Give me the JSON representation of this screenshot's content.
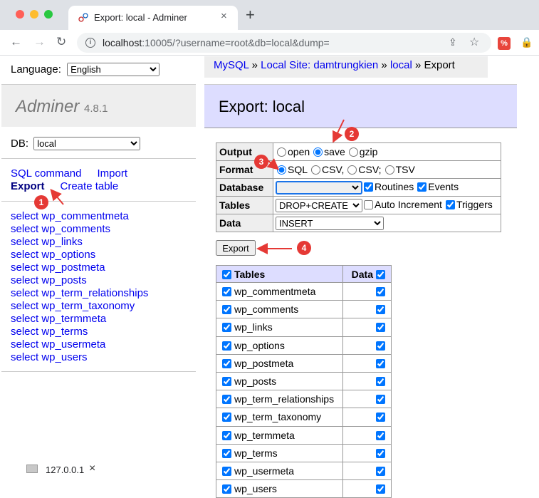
{
  "browser": {
    "tab_title": "Export: local - Adminer",
    "tab_close": "×",
    "new_tab": "+",
    "url_host": "localhost",
    "url_rest": ":10005/?username=root&db=local&dump=",
    "icons": [
      "back-icon",
      "forward-icon",
      "reload-icon",
      "info-icon",
      "share-icon",
      "star-icon",
      "extension-icon",
      "lock-extension-icon"
    ]
  },
  "sidebar": {
    "language_label": "Language:",
    "language_value": "English",
    "logo": "Adminer",
    "version": "4.8.1",
    "db_label": "DB:",
    "db_value": "local",
    "links": {
      "sql_command": "SQL command",
      "import": "Import",
      "export": "Export",
      "create_table": "Create table"
    },
    "tables": [
      "select wp_commentmeta",
      "select wp_comments",
      "select wp_links",
      "select wp_options",
      "select wp_postmeta",
      "select wp_posts",
      "select wp_term_relationships",
      "select wp_term_taxonomy",
      "select wp_termmeta",
      "select wp_terms",
      "select wp_usermeta",
      "select wp_users"
    ]
  },
  "breadcrumb": {
    "mysql": "MySQL",
    "sep": " » ",
    "site": "Local Site: damtrungkien",
    "db": "local",
    "current": "Export"
  },
  "content": {
    "title": "Export: local"
  },
  "options": {
    "output_label": "Output",
    "output_options": [
      "open",
      "save",
      "gzip"
    ],
    "output_selected": "save",
    "format_label": "Format",
    "format_options": [
      "SQL",
      "CSV,",
      "CSV;",
      "TSV"
    ],
    "format_selected": "SQL",
    "database_label": "Database",
    "database_value": "",
    "routines_label": "Routines",
    "events_label": "Events",
    "tables_label": "Tables",
    "tables_value": "DROP+CREATE",
    "auto_increment_label": "Auto Increment",
    "triggers_label": "Triggers",
    "data_label": "Data",
    "data_value": "INSERT"
  },
  "export_button": "Export",
  "tables_table": {
    "header_tables": "Tables",
    "header_data": "Data",
    "rows": [
      "wp_commentmeta",
      "wp_comments",
      "wp_links",
      "wp_options",
      "wp_postmeta",
      "wp_posts",
      "wp_term_relationships",
      "wp_term_taxonomy",
      "wp_termmeta",
      "wp_terms",
      "wp_usermeta",
      "wp_users"
    ]
  },
  "downloads": {
    "host": "127.0.0.1",
    "close": "×"
  },
  "annotations": [
    "1",
    "2",
    "3",
    "4"
  ],
  "colors": {
    "annotation": "#e53935",
    "link": "#0000ee",
    "header_bg": "#ddf"
  }
}
